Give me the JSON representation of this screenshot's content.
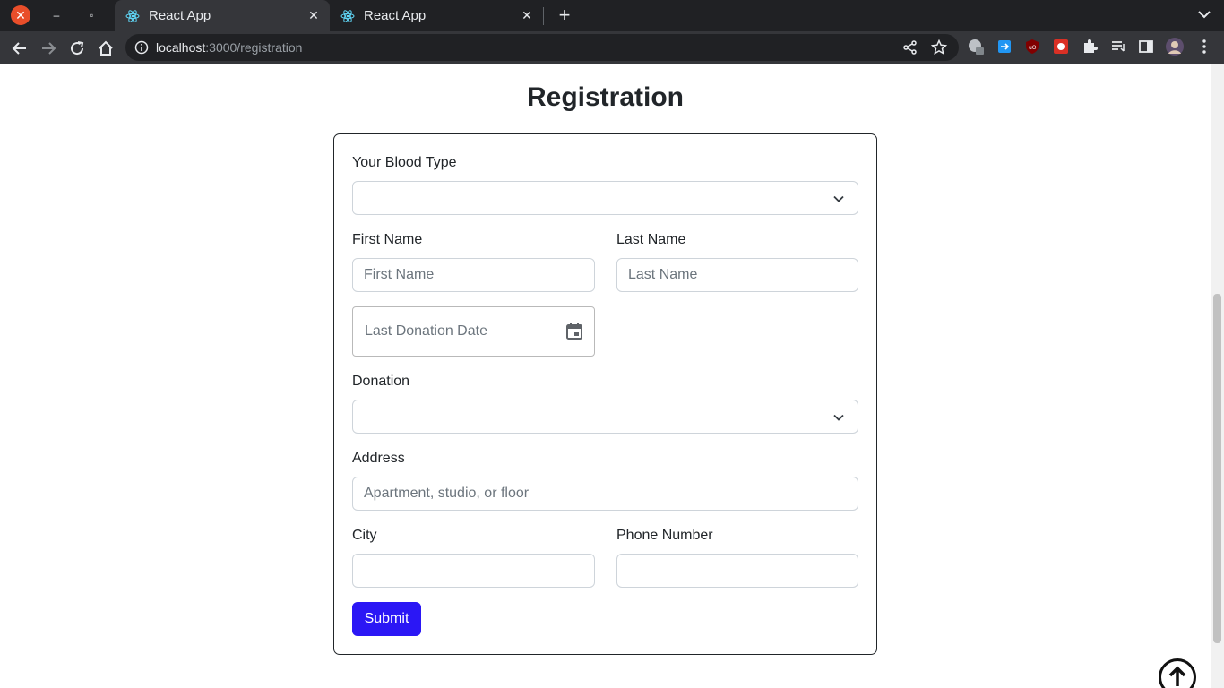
{
  "browser": {
    "tabs": [
      {
        "title": "React App",
        "active": true
      },
      {
        "title": "React App",
        "active": false
      }
    ],
    "url_host": "localhost",
    "url_path": ":3000/registration"
  },
  "page": {
    "title": "Registration"
  },
  "form": {
    "blood_type_label": "Your Blood Type",
    "blood_type_value": "",
    "first_name_label": "First Name",
    "first_name_placeholder": "First Name",
    "last_name_label": "Last Name",
    "last_name_placeholder": "Last Name",
    "last_donation_placeholder": "Last Donation Date",
    "donation_label": "Donation",
    "donation_value": "",
    "address_label": "Address",
    "address_placeholder": "Apartment, studio, or floor",
    "city_label": "City",
    "phone_label": "Phone Number",
    "submit_label": "Submit"
  },
  "colors": {
    "submit_bg": "#2b17f5",
    "tab_bar": "#202124",
    "toolbar": "#35363a"
  },
  "icons": [
    "close-window-icon",
    "minimize-icon",
    "restore-icon",
    "react-icon",
    "tab-close-icon",
    "new-tab-icon",
    "back-icon",
    "forward-icon",
    "reload-icon",
    "home-icon",
    "info-icon",
    "share-icon",
    "bookmark-star-icon",
    "extension-icon",
    "puzzle-icon",
    "reading-list-icon",
    "side-panel-icon",
    "profile-avatar",
    "kebab-menu-icon",
    "chevron-down-icon",
    "calendar-icon",
    "arrow-up-circle-icon"
  ]
}
